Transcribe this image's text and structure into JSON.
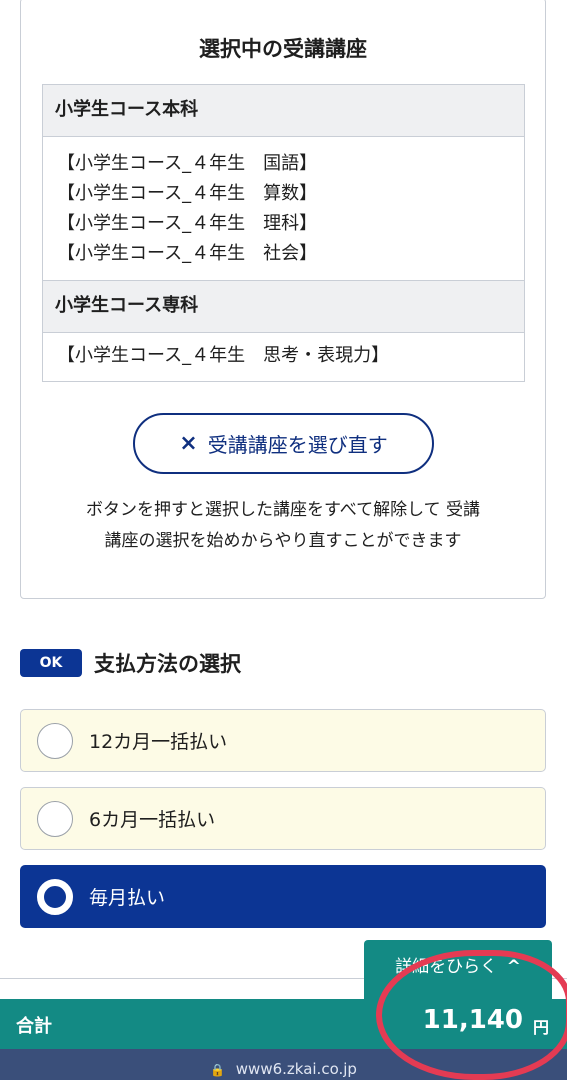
{
  "selected_courses": {
    "title": "選択中の受講講座",
    "groups": [
      {
        "heading": "小学生コース本科",
        "items": [
          "【小学生コース_４年生　国語】",
          "【小学生コース_４年生　算数】",
          "【小学生コース_４年生　理科】",
          "【小学生コース_４年生　社会】"
        ]
      },
      {
        "heading": "小学生コース専科",
        "items": [
          "【小学生コース_４年生　思考・表現力】"
        ]
      }
    ],
    "reset_button": {
      "icon": "×",
      "label": "受講講座を選び直す"
    },
    "note_line1": "ボタンを押すと選択した講座をすべて解除して 受講",
    "note_line2": "講座の選択を始めからやり直すことができます"
  },
  "payment": {
    "badge": "OK",
    "title": "支払方法の選択",
    "options": [
      {
        "label": "12カ月一括払い",
        "selected": false
      },
      {
        "label": "6カ月一括払い",
        "selected": false
      },
      {
        "label": "毎月払い",
        "selected": true
      }
    ]
  },
  "footer": {
    "details_tab": "詳細をひらく",
    "details_icon": "^",
    "total_label": "合計",
    "total_amount": "11,140",
    "total_unit": "円",
    "url": "www6.zkai.co.jp"
  },
  "colors": {
    "navy": "#0c3594",
    "teal": "#138a84",
    "option_bg": "#fdfbe6",
    "annotation": "#e43b53"
  }
}
